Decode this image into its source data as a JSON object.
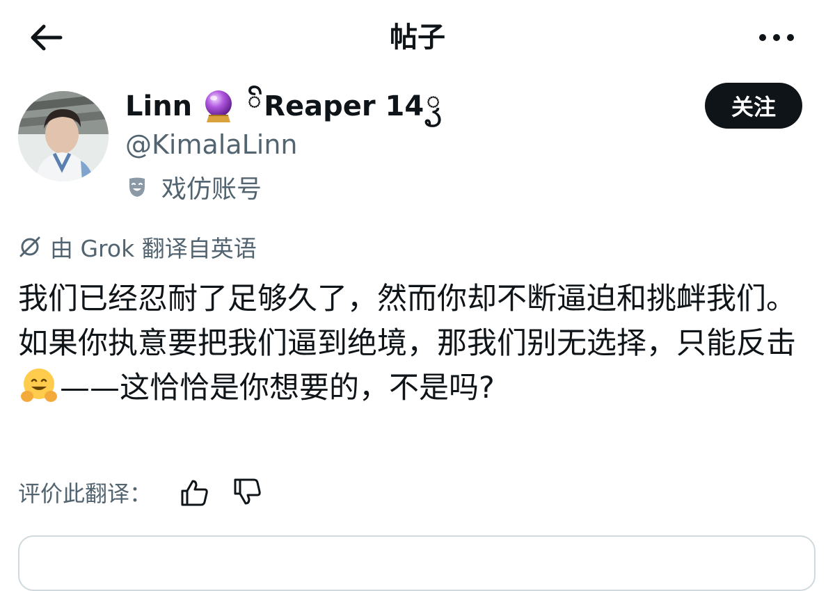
{
  "header": {
    "title": "帖子",
    "back_icon": "arrow-left-icon",
    "more_icon": "more-horizontal-icon"
  },
  "author": {
    "name": "Linn",
    "name_suffix": "Reaper 14",
    "handle": "@KimalaLinn",
    "badge_icon": "crystal-ball-icon",
    "parody_label": "戏仿账号",
    "parody_icon": "theater-mask-icon"
  },
  "follow_button": {
    "label": "关注"
  },
  "translation": {
    "notice": "由 Grok 翻译自英语",
    "notice_icon": "grok-icon",
    "rate_label": "评价此翻译：",
    "thumbs_up_icon": "thumbs-up-icon",
    "thumbs_down_icon": "thumbs-down-icon"
  },
  "post": {
    "text_before": "我们已经忍耐了足够久了，然而你却不断逼迫和挑衅我们。如果你执意要把我们逼到绝境，那我们别无选择，只能反击",
    "emoji": "hugging-face-emoji",
    "text_after": "——这恰恰是你想要的，不是吗?"
  },
  "colors": {
    "text": "#0f1419",
    "secondary_text": "#536471",
    "follow_bg": "#0f1419",
    "follow_text": "#ffffff",
    "border": "#cfd9de"
  }
}
